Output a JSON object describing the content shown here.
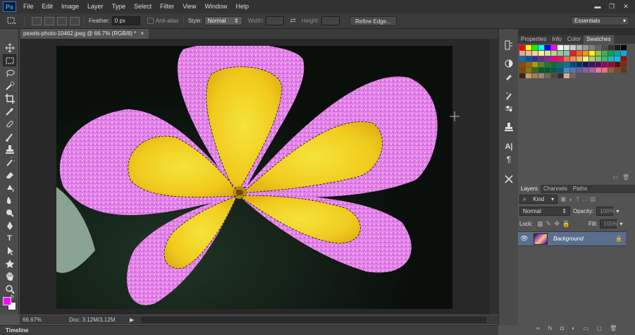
{
  "app": {
    "logo": "Ps"
  },
  "menu": [
    "File",
    "Edit",
    "Image",
    "Layer",
    "Type",
    "Select",
    "Filter",
    "View",
    "Window",
    "Help"
  ],
  "window_controls": [
    "▬",
    "❐",
    "✕"
  ],
  "options": {
    "feather_label": "Feather:",
    "feather_value": "0 px",
    "anti_alias_label": "Anti-alias",
    "style_label": "Style:",
    "style_value": "Normal",
    "width_label": "Width:",
    "height_label": "Height:",
    "refine_edge": "Refine Edge...",
    "workspace": "Essentials"
  },
  "document": {
    "tab_title": "pexels-photo-10462.jpeg @ 66.7% (RGB/8) *",
    "close": "×"
  },
  "status": {
    "zoom": "66.67%",
    "doc_info": "Doc: 3.12M/3.12M",
    "arrow": "▶"
  },
  "timeline_label": "Timeline",
  "swatch_panel": {
    "tabs": [
      "Properties",
      "Info",
      "Color",
      "Swatches"
    ],
    "active_tab": "Swatches",
    "colors": [
      "#ff0000",
      "#ffff00",
      "#00ff00",
      "#00ffff",
      "#0000ff",
      "#ff00ff",
      "#ffffff",
      "#e6e6e6",
      "#cccccc",
      "#b3b3b3",
      "#999999",
      "#808080",
      "#666666",
      "#4d4d4d",
      "#333333",
      "#1a1a1a",
      "#000000",
      "#f2a28a",
      "#f6b98b",
      "#fbd28d",
      "#fff799",
      "#d6e690",
      "#b3d88f",
      "#8dce8f",
      "#7dcbb5",
      "#ed1c24",
      "#f26522",
      "#f7941d",
      "#fff200",
      "#8dc63f",
      "#39b54a",
      "#00a651",
      "#00a99d",
      "#00aeef",
      "#0072bc",
      "#0054a6",
      "#2e3192",
      "#662d91",
      "#92278f",
      "#ec008c",
      "#ed145b",
      "#f26c4f",
      "#f68e56",
      "#fbaf5d",
      "#fff568",
      "#acd373",
      "#7cc576",
      "#3cb878",
      "#1cbbb4",
      "#00bff3",
      "#9e0b0f",
      "#a0410d",
      "#a3620a",
      "#aba000",
      "#598527",
      "#197b30",
      "#007236",
      "#00746b",
      "#0076a3",
      "#004a80",
      "#003471",
      "#1b1464",
      "#440e62",
      "#630460",
      "#9e005d",
      "#9e0039",
      "#790000",
      "#7b2e00",
      "#7d4900",
      "#827b00",
      "#406618",
      "#005e20",
      "#005826",
      "#005952",
      "#005b7f",
      "#448ccb",
      "#5674b9",
      "#605ca8",
      "#8560a8",
      "#a864a8",
      "#f06eaa",
      "#f26d7d",
      "#8c6239",
      "#754c24",
      "#603913",
      "#3c2415",
      "#c69c6d",
      "#a67c52",
      "#998675",
      "#736357",
      "#534741",
      "#362f2d",
      "#c7b299",
      "#736357"
    ]
  },
  "layers": {
    "tabs": [
      "Layers",
      "Channels",
      "Paths"
    ],
    "active_tab": "Layers",
    "filter_label": "Kind",
    "blend_mode": "Normal",
    "opacity_label": "Opacity:",
    "opacity_value": "100%",
    "lock_label": "Lock:",
    "fill_label": "Fill:",
    "fill_value": "100%",
    "items": [
      {
        "name": "Background",
        "visible": true,
        "locked": true
      }
    ]
  }
}
